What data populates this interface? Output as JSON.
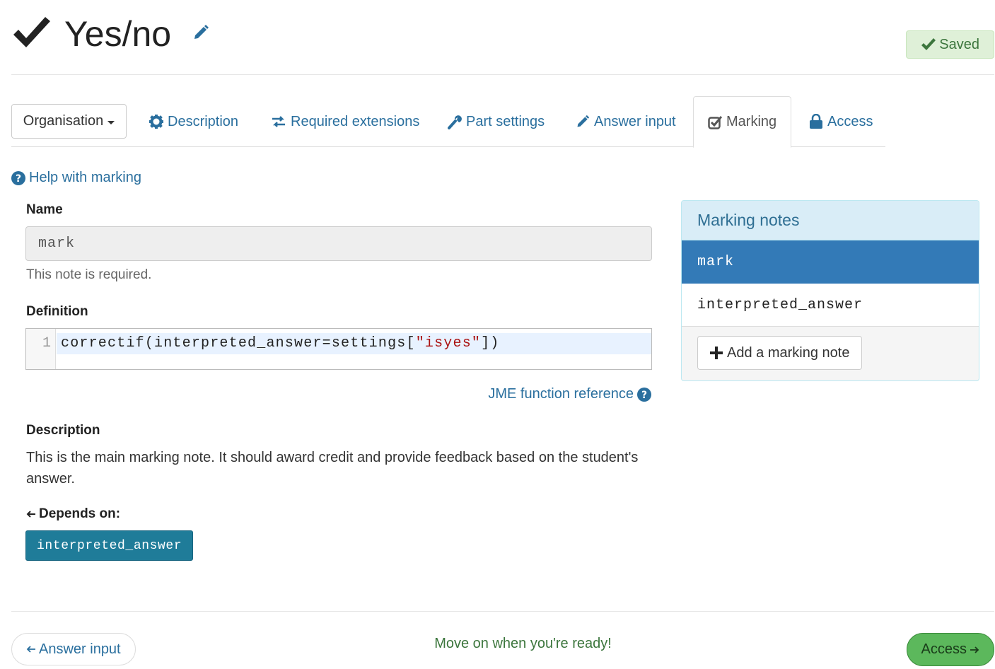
{
  "header": {
    "title": "Yes/no",
    "title_icon": "check-icon",
    "edit_icon": "pencil-icon",
    "saved_label": "Saved"
  },
  "tabs": {
    "organisation_label": "Organisation",
    "items": [
      {
        "label": "Description",
        "icon": "gear-icon"
      },
      {
        "label": "Required extensions",
        "icon": "exchange-icon"
      },
      {
        "label": "Part settings",
        "icon": "wrench-icon"
      },
      {
        "label": "Answer input",
        "icon": "pencil-icon"
      },
      {
        "label": "Marking",
        "icon": "checkbox-icon",
        "active": true
      },
      {
        "label": "Access",
        "icon": "lock-icon"
      }
    ]
  },
  "help_link": "Help with marking",
  "form": {
    "name_label": "Name",
    "name_value": "mark",
    "name_help": "This note is required.",
    "definition_label": "Definition",
    "line_number": "1",
    "code_prefix": "correctif(interpreted_answer=settings[",
    "code_string": "\"isyes\"",
    "code_suffix": "])",
    "jme_link": "JME function reference",
    "description_label": "Description",
    "description_text": "This is the main marking note. It should award credit and provide feedback based on the student's answer.",
    "depends_label": "Depends on:",
    "depends_items": [
      "interpreted_answer"
    ]
  },
  "marking_notes": {
    "heading": "Marking notes",
    "items": [
      {
        "name": "mark",
        "active": true
      },
      {
        "name": "interpreted_answer",
        "active": false
      }
    ],
    "add_button": "Add a marking note"
  },
  "footer": {
    "back_label": "Answer input",
    "message": "Move on when you're ready!",
    "next_label": "Access"
  },
  "colors": {
    "link": "#2a6f9e",
    "active_note": "#337ab7",
    "depends_badge": "#1f7c99",
    "success": "#5cb85c",
    "saved_bg": "#dff0d8"
  }
}
